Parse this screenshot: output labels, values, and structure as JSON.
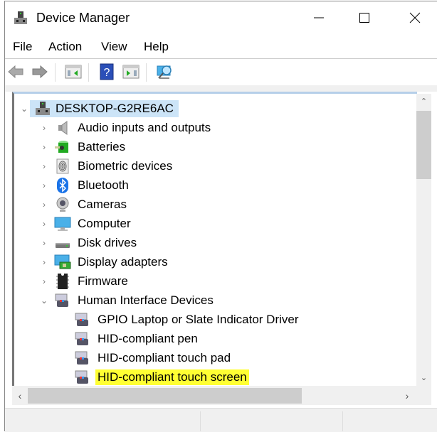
{
  "window": {
    "title": "Device Manager",
    "controls": {
      "minimize": "minimize",
      "maximize": "maximize",
      "close": "close"
    }
  },
  "menubar": {
    "items": [
      {
        "label": "File"
      },
      {
        "label": "Action"
      },
      {
        "label": "View"
      },
      {
        "label": "Help"
      }
    ]
  },
  "toolbar": {
    "buttons": [
      {
        "icon": "back-arrow-icon"
      },
      {
        "icon": "forward-arrow-icon"
      },
      {
        "icon": "show-hide-console-tree-icon"
      },
      {
        "icon": "help-icon"
      },
      {
        "icon": "show-hide-action-pane-icon"
      },
      {
        "icon": "scan-hardware-icon"
      }
    ]
  },
  "tree": {
    "root": {
      "label": "DESKTOP-G2RE6AC",
      "expanded": true,
      "selected": true
    },
    "categories": [
      {
        "label": "Audio inputs and outputs",
        "icon": "speaker-icon",
        "expanded": false
      },
      {
        "label": "Batteries",
        "icon": "battery-icon",
        "expanded": false
      },
      {
        "label": "Biometric devices",
        "icon": "fingerprint-icon",
        "expanded": false
      },
      {
        "label": "Bluetooth",
        "icon": "bluetooth-icon",
        "expanded": false
      },
      {
        "label": "Cameras",
        "icon": "webcam-icon",
        "expanded": false
      },
      {
        "label": "Computer",
        "icon": "monitor-icon",
        "expanded": false
      },
      {
        "label": "Disk drives",
        "icon": "disk-drive-icon",
        "expanded": false
      },
      {
        "label": "Display adapters",
        "icon": "display-adapter-icon",
        "expanded": false
      },
      {
        "label": "Firmware",
        "icon": "chip-icon",
        "expanded": false
      },
      {
        "label": "Human Interface Devices",
        "icon": "hid-icon",
        "expanded": true
      }
    ],
    "hid_children": [
      {
        "label": "GPIO Laptop or Slate Indicator Driver",
        "highlighted": false
      },
      {
        "label": "HID-compliant pen",
        "highlighted": false
      },
      {
        "label": "HID-compliant touch pad",
        "highlighted": false
      },
      {
        "label": "HID-compliant touch screen",
        "highlighted": true
      }
    ]
  },
  "colors": {
    "selection": "#cce4f7",
    "highlight": "#ffff33",
    "bluetooth": "#1a73e8"
  }
}
